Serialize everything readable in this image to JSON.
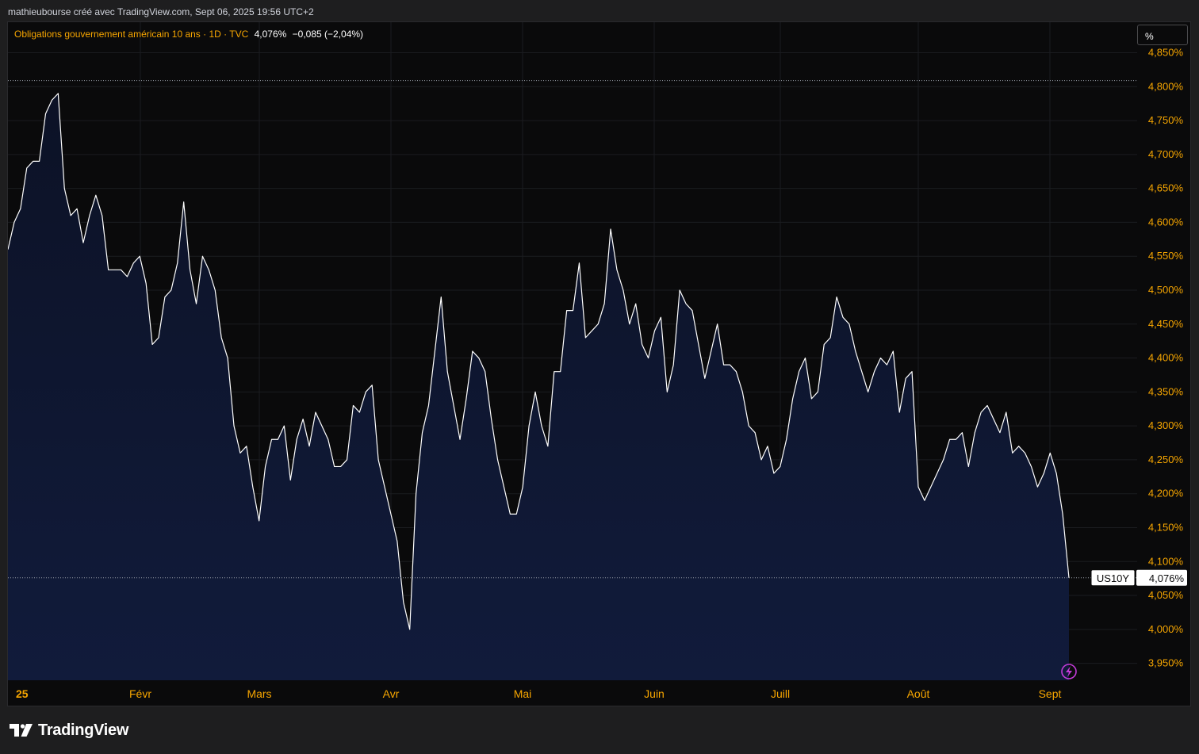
{
  "header": {
    "caption": "mathieubourse créé avec TradingView.com, Sept 06, 2025 19:56 UTC+2"
  },
  "legend": {
    "symbol_text": "Obligations gouvernement américain 10 ans · 1D · TVC",
    "last_value": "4,076%",
    "change": "−0,085 (−2,04%)"
  },
  "unit_button": {
    "label": "%"
  },
  "price_label": {
    "symbol": "US10Y",
    "value": "4,076%"
  },
  "footer": {
    "brand": "TradingView"
  },
  "colors": {
    "accent": "#f7a600",
    "line": "#ffffff",
    "area_top": "#0c1226",
    "area_bottom": "#111b3b",
    "background": "#0a0a0b"
  },
  "chart_data": {
    "type": "area",
    "title": "Obligations gouvernement américain 10 ans · 1D · TVC",
    "xlabel": "",
    "ylabel": "",
    "x_tick_labels": [
      "25",
      "Févr",
      "Mars",
      "Avr",
      "Mai",
      "Juin",
      "Juill",
      "Août",
      "Sept"
    ],
    "y_ticks": [
      "3,950%",
      "4,000%",
      "4,050%",
      "4,100%",
      "4,150%",
      "4,200%",
      "4,250%",
      "4,300%",
      "4,350%",
      "4,400%",
      "4,450%",
      "4,500%",
      "4,550%",
      "4,600%",
      "4,650%",
      "4,700%",
      "4,750%",
      "4,800%",
      "4,850%"
    ],
    "ylim": [
      3.925,
      4.895
    ],
    "grid": true,
    "legend_position": "top-left",
    "reference_lines": [
      4.809,
      4.076
    ],
    "series": [
      {
        "values": [
          4.56,
          4.6,
          4.62,
          4.68,
          4.69,
          4.69,
          4.76,
          4.78,
          4.79,
          4.65,
          4.61,
          4.62,
          4.57,
          4.61,
          4.64,
          4.61,
          4.53,
          4.53,
          4.53,
          4.52,
          4.54,
          4.55,
          4.51,
          4.42,
          4.43,
          4.49,
          4.5,
          4.54,
          4.63,
          4.53,
          4.48,
          4.55,
          4.53,
          4.5,
          4.43,
          4.4,
          4.3,
          4.26,
          4.27,
          4.21,
          4.16,
          4.24,
          4.28,
          4.28,
          4.3,
          4.22,
          4.28,
          4.31,
          4.27,
          4.32,
          4.3,
          4.28,
          4.24,
          4.24,
          4.25,
          4.33,
          4.32,
          4.35,
          4.36,
          4.25,
          4.21,
          4.17,
          4.13,
          4.04,
          4.0,
          4.2,
          4.29,
          4.33,
          4.41,
          4.49,
          4.38,
          4.33,
          4.28,
          4.34,
          4.41,
          4.4,
          4.38,
          4.31,
          4.25,
          4.21,
          4.17,
          4.17,
          4.21,
          4.3,
          4.35,
          4.3,
          4.27,
          4.38,
          4.38,
          4.47,
          4.47,
          4.54,
          4.43,
          4.44,
          4.45,
          4.48,
          4.59,
          4.53,
          4.5,
          4.45,
          4.48,
          4.42,
          4.4,
          4.44,
          4.46,
          4.35,
          4.39,
          4.5,
          4.48,
          4.47,
          4.42,
          4.37,
          4.41,
          4.45,
          4.39,
          4.39,
          4.38,
          4.35,
          4.3,
          4.29,
          4.25,
          4.27,
          4.23,
          4.24,
          4.28,
          4.34,
          4.38,
          4.4,
          4.34,
          4.35,
          4.42,
          4.43,
          4.49,
          4.46,
          4.45,
          4.41,
          4.38,
          4.35,
          4.38,
          4.4,
          4.39,
          4.41,
          4.32,
          4.37,
          4.38,
          4.21,
          4.19,
          4.21,
          4.23,
          4.25,
          4.28,
          4.28,
          4.29,
          4.24,
          4.29,
          4.32,
          4.33,
          4.31,
          4.29,
          4.32,
          4.26,
          4.27,
          4.26,
          4.24,
          4.21,
          4.23,
          4.26,
          4.23,
          4.17,
          4.076
        ]
      }
    ]
  }
}
